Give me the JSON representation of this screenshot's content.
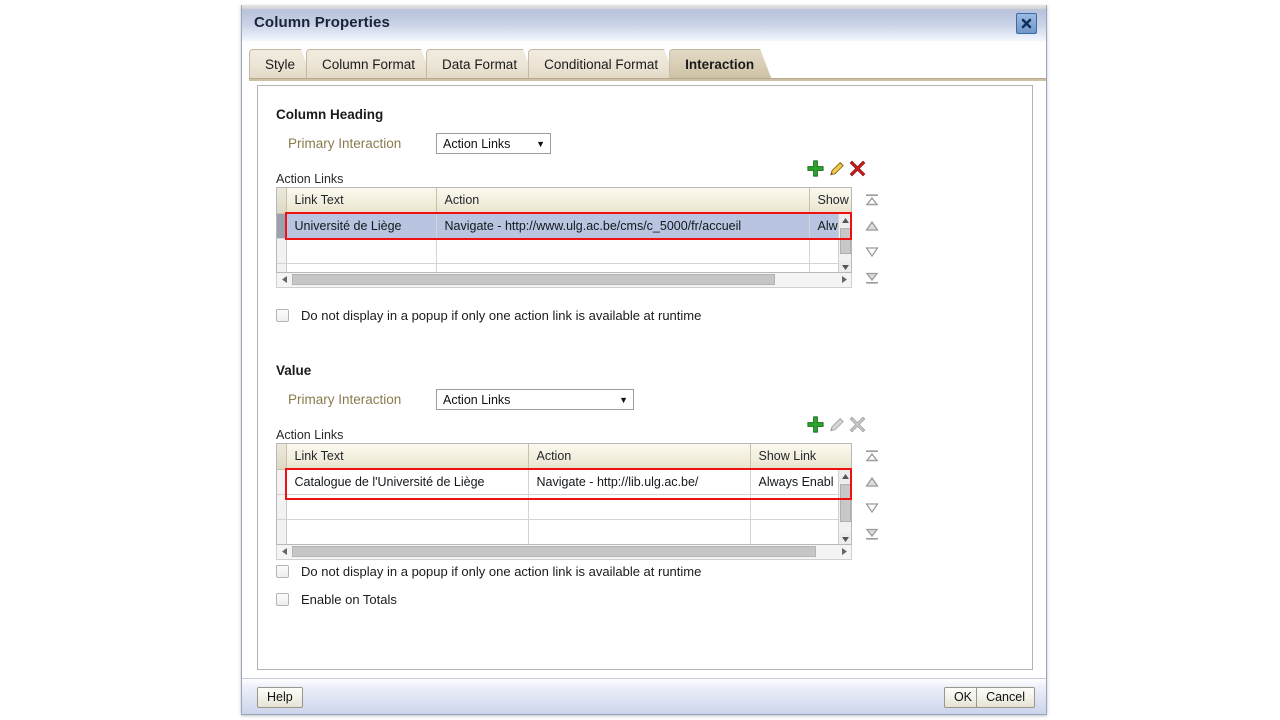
{
  "dialog": {
    "title": "Column Properties",
    "close_icon": "close-icon"
  },
  "tabs": [
    {
      "label": "Style",
      "active": false
    },
    {
      "label": "Column Format",
      "active": false
    },
    {
      "label": "Data Format",
      "active": false
    },
    {
      "label": "Conditional Format",
      "active": false
    },
    {
      "label": "Interaction",
      "active": true
    }
  ],
  "column_heading": {
    "section_label": "Column Heading",
    "primary_interaction_label": "Primary Interaction",
    "primary_interaction_value": "Action Links",
    "action_links_label": "Action Links",
    "toolbar": {
      "add_label": "Add Action Link",
      "edit_label": "Edit Action Link",
      "delete_label": "Delete Action Link",
      "add_enabled": true,
      "edit_enabled": true,
      "delete_enabled": true
    },
    "columns": [
      "Link Text",
      "Action",
      "Show"
    ],
    "rows": [
      {
        "link_text": "Université de Liège",
        "action": "Navigate - http://www.ulg.ac.be/cms/c_5000/fr/accueil",
        "show_link": "Alw",
        "selected": true
      },
      {
        "link_text": "",
        "action": "",
        "show_link": "",
        "selected": false
      },
      {
        "link_text": "",
        "action": "",
        "show_link": "",
        "selected": false
      }
    ],
    "checkbox_popup_label": "Do not display in a popup if only one action link is available at runtime",
    "checkbox_popup_checked": false
  },
  "value": {
    "section_label": "Value",
    "primary_interaction_label": "Primary Interaction",
    "primary_interaction_value": "Action Links",
    "action_links_label": "Action Links",
    "toolbar": {
      "add_label": "Add Action Link",
      "edit_label": "Edit Action Link",
      "delete_label": "Delete Action Link",
      "add_enabled": true,
      "edit_enabled": false,
      "delete_enabled": false
    },
    "columns": [
      "Link Text",
      "Action",
      "Show Link"
    ],
    "rows": [
      {
        "link_text": "Catalogue de l'Université de Liège",
        "action": "Navigate - http://lib.ulg.ac.be/",
        "show_link": "Always Enabl",
        "selected": false
      },
      {
        "link_text": "",
        "action": "",
        "show_link": "",
        "selected": false
      },
      {
        "link_text": "",
        "action": "",
        "show_link": "",
        "selected": false
      }
    ],
    "checkbox_popup_label": "Do not display in a popup if only one action link is available at runtime",
    "checkbox_popup_checked": false,
    "checkbox_totals_label": "Enable on Totals",
    "checkbox_totals_checked": false
  },
  "move_buttons": {
    "top_label": "Move to Top",
    "up_label": "Move Up",
    "down_label": "Move Down",
    "bottom_label": "Move to Bottom"
  },
  "footer": {
    "help_label": "Help",
    "ok_label": "OK",
    "cancel_label": "Cancel"
  },
  "colors": {
    "title_text": "#19243a",
    "label_olive": "#8a7a4e",
    "highlight_red": "#ee1111",
    "row_selected": "#b9c5e0",
    "tab_active": "#cdc0a4",
    "icon_add_green": "#2ea32e",
    "icon_edit_yellow": "#e8b226",
    "icon_delete_red": "#cc2020",
    "icon_disabled_gray": "#a8a8a8"
  }
}
